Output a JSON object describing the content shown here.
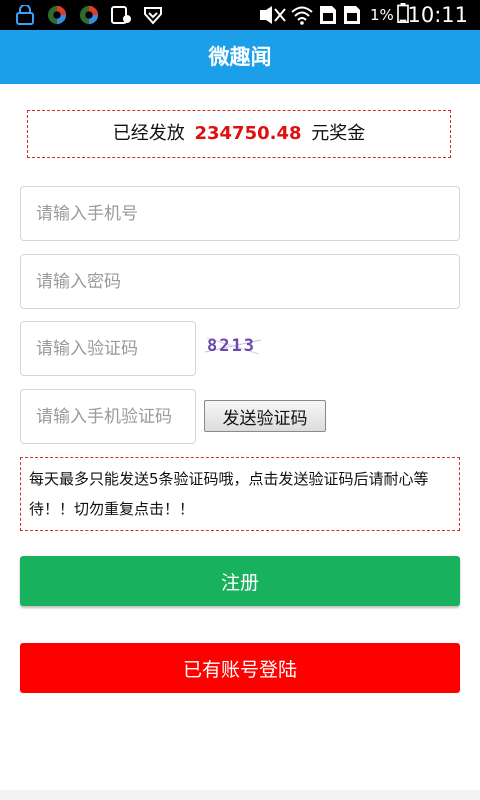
{
  "status_bar": {
    "battery_percent": "1%",
    "time": "10:11",
    "icons": [
      "usb-lock-icon",
      "circle-app-icon",
      "circle-app-icon",
      "notification-icon",
      "shield-icon",
      "signal-mute-icon",
      "wifi-icon",
      "sim-card-icon",
      "sim-card-icon",
      "battery-icon"
    ]
  },
  "app": {
    "title": "微趣闻"
  },
  "bonus": {
    "prefix": "已经发放",
    "amount": "234750.48",
    "suffix": "元奖金"
  },
  "form": {
    "phone_placeholder": "请输入手机号",
    "password_placeholder": "请输入密码",
    "captcha_placeholder": "请输入验证码",
    "captcha_image_text": "8213",
    "sms_code_placeholder": "请输入手机验证码",
    "send_code_label": "发送验证码"
  },
  "notice": {
    "text": "每天最多只能发送5条验证码哦，点击发送验证码后请耐心等待！！切勿重复点击！！"
  },
  "buttons": {
    "register_label": "注册",
    "login_label": "已有账号登陆"
  },
  "colors": {
    "header": "#1a9fe8",
    "amount": "#e01010",
    "register": "#18b15e",
    "login": "#ff0000"
  }
}
